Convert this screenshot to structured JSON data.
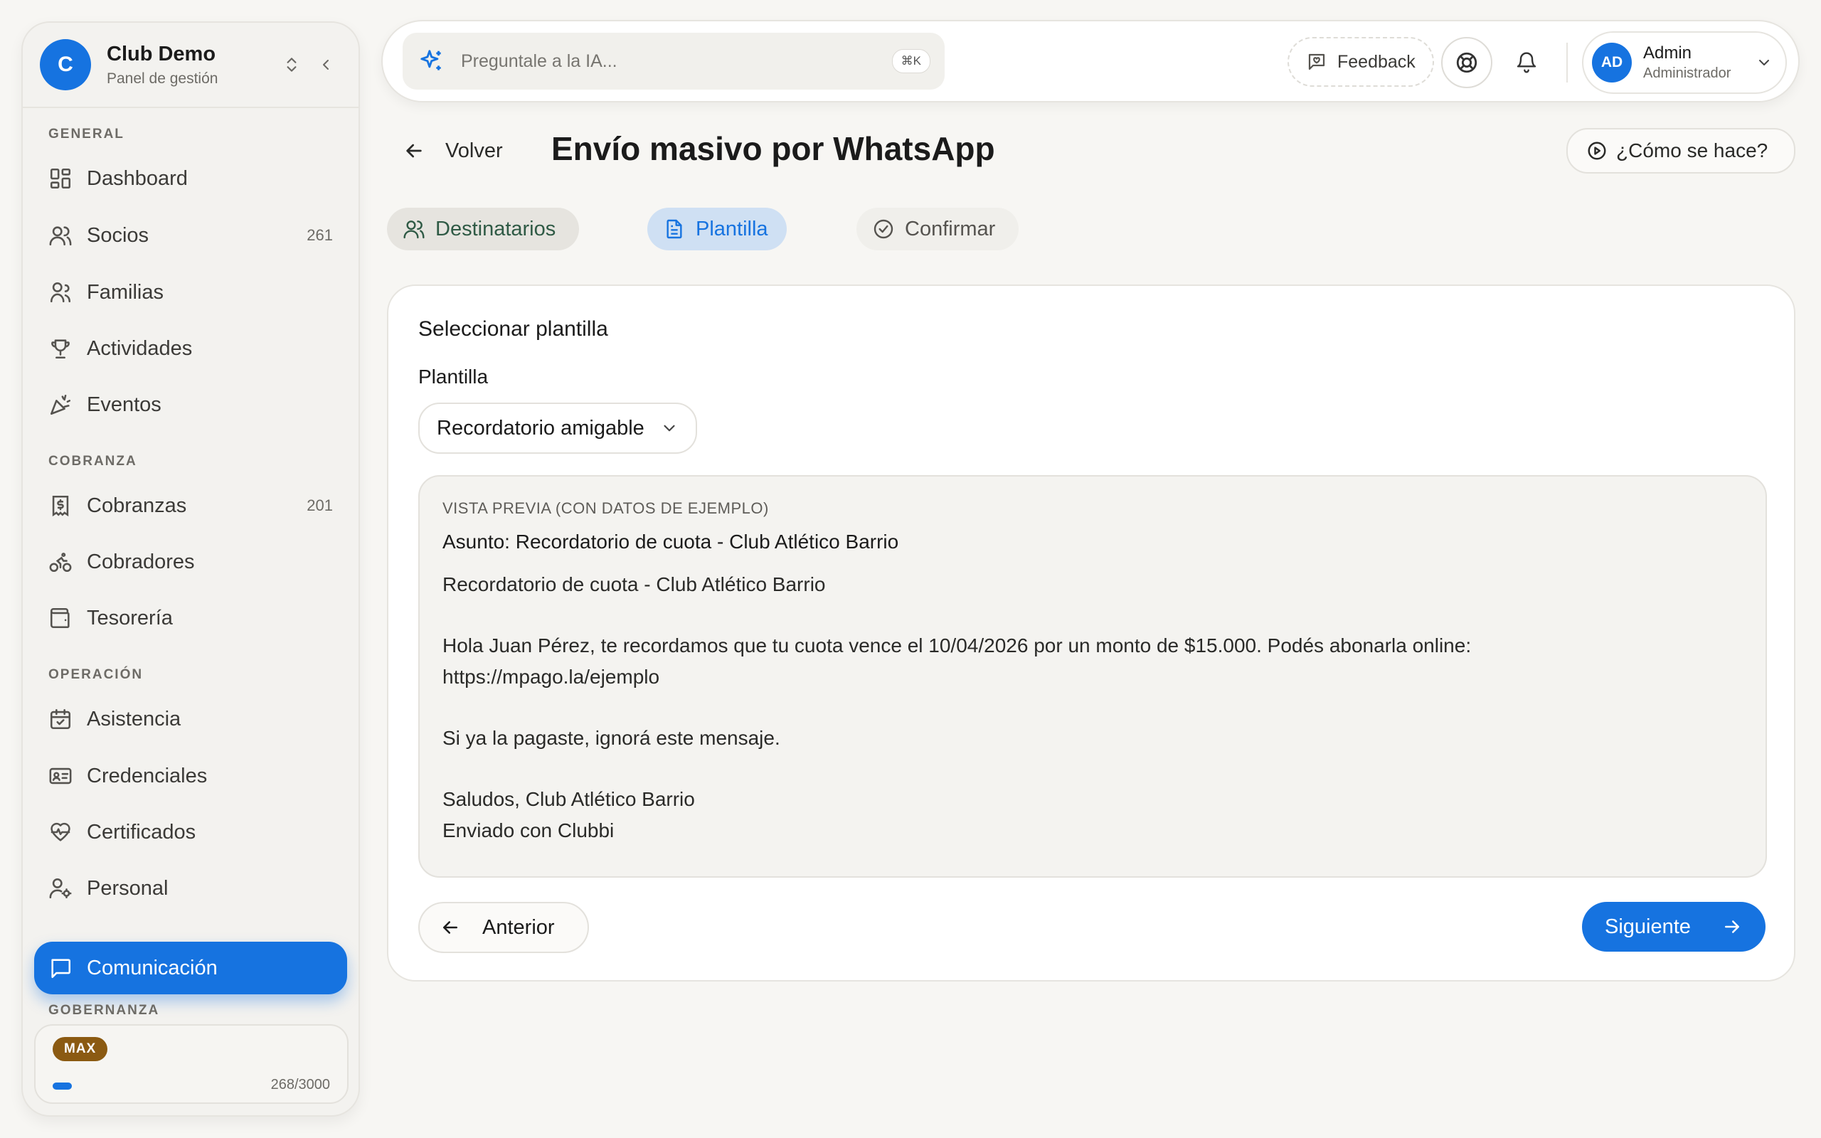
{
  "sidebar": {
    "club_initial": "C",
    "club_name": "Club Demo",
    "club_subtitle": "Panel de gestión",
    "sections": {
      "general": "GENERAL",
      "cobranza": "COBRANZA",
      "operacion": "OPERACIÓN",
      "gobernanza": "GOBERNANZA"
    },
    "items": [
      {
        "label": "Dashboard",
        "icon": "dashboard-icon"
      },
      {
        "label": "Socios",
        "count": "261",
        "icon": "users-icon"
      },
      {
        "label": "Familias",
        "icon": "family-icon"
      },
      {
        "label": "Actividades",
        "icon": "trophy-icon"
      },
      {
        "label": "Eventos",
        "icon": "party-icon"
      },
      {
        "label": "Cobranzas",
        "count": "201",
        "icon": "receipt-icon"
      },
      {
        "label": "Cobradores",
        "icon": "bike-icon"
      },
      {
        "label": "Tesorería",
        "icon": "wallet-icon"
      },
      {
        "label": "Asistencia",
        "icon": "calendar-check-icon"
      },
      {
        "label": "Credenciales",
        "icon": "id-card-icon"
      },
      {
        "label": "Certificados",
        "icon": "heart-pulse-icon"
      },
      {
        "label": "Personal",
        "icon": "user-cog-icon"
      },
      {
        "label": "Comunicación",
        "icon": "message-icon",
        "active": true
      }
    ],
    "plan": {
      "badge": "MAX",
      "usage": "268/3000",
      "usage_fraction": 0.0893
    }
  },
  "topbar": {
    "ai_placeholder": "Preguntale a la IA...",
    "ai_shortcut": "⌘K",
    "feedback_label": "Feedback",
    "user_initials": "AD",
    "user_name": "Admin",
    "user_role": "Administrador"
  },
  "page": {
    "back_label": "Volver",
    "title": "Envío masivo por WhatsApp",
    "howto_label": "¿Cómo se hace?"
  },
  "steps": [
    {
      "label": "Destinatarios",
      "state": "done"
    },
    {
      "label": "Plantilla",
      "state": "current"
    },
    {
      "label": "Confirmar",
      "state": "pending"
    }
  ],
  "card": {
    "title": "Seleccionar plantilla",
    "field_label": "Plantilla",
    "selected_template": "Recordatorio amigable",
    "preview": {
      "label": "VISTA PREVIA (CON DATOS DE EJEMPLO)",
      "subject": "Asunto: Recordatorio de cuota - Club Atlético Barrio",
      "line1": "Recordatorio de cuota - Club Atlético Barrio",
      "line2": "Hola Juan Pérez, te recordamos que tu cuota vence el 10/04/2026 por un monto de $15.000. Podés abonarla online:",
      "line3": "https://mpago.la/ejemplo",
      "line4": "Si ya la pagaste, ignorá este mensaje.",
      "line5": "Saludos, Club Atlético Barrio",
      "line6": "Enviado con Clubbi"
    },
    "prev_label": "Anterior",
    "next_label": "Siguiente"
  },
  "colors": {
    "primary": "#1673e0",
    "background": "#f7f6f3",
    "plan_badge": "#8b5a12"
  }
}
